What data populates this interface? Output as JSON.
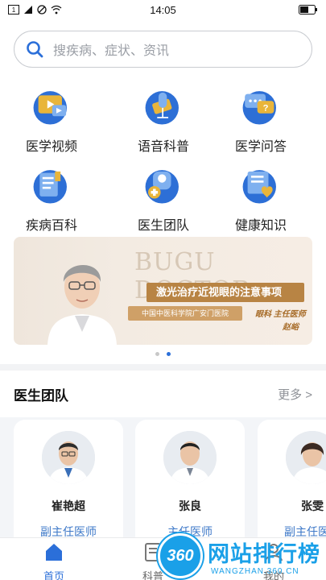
{
  "status_bar": {
    "time": "14:05"
  },
  "search": {
    "placeholder": "搜疾病、症状、资讯"
  },
  "features": [
    {
      "label": "医学视频",
      "icon": "video-icon"
    },
    {
      "label": "语音科普",
      "icon": "microphone-icon"
    },
    {
      "label": "医学问答",
      "icon": "qa-chat-icon"
    },
    {
      "label": "疾病百科",
      "icon": "encyclopedia-icon"
    },
    {
      "label": "医生团队",
      "icon": "doctor-team-icon"
    },
    {
      "label": "健康知识",
      "icon": "health-knowledge-icon"
    }
  ],
  "banner": {
    "bg_text": "BUGU DOCTOR",
    "title": "激光治疗近视眼的注意事项",
    "hospital": "中国中医科学院广安门医院",
    "department": "眼科  主任医师",
    "doctor": "赵峪"
  },
  "carousel": {
    "count": 2,
    "active": 1
  },
  "section": {
    "title": "医生团队",
    "more": "更多 >"
  },
  "doctors": [
    {
      "name": "崔艳超",
      "title": "副主任医师"
    },
    {
      "name": "张良",
      "title": "主任医师"
    },
    {
      "name": "张雯",
      "title": "副主任医师"
    }
  ],
  "tabs": [
    {
      "label": "首页",
      "active": true
    },
    {
      "label": "科普",
      "active": false
    },
    {
      "label": "我的",
      "active": false
    }
  ],
  "watermark": {
    "logo": "360",
    "text": "网站排行榜",
    "url": "WANGZHAN.360.CN"
  },
  "colors": {
    "accent": "#2b6fd9",
    "title_blue": "#3d78c8",
    "banner_gold": "#b88444"
  }
}
